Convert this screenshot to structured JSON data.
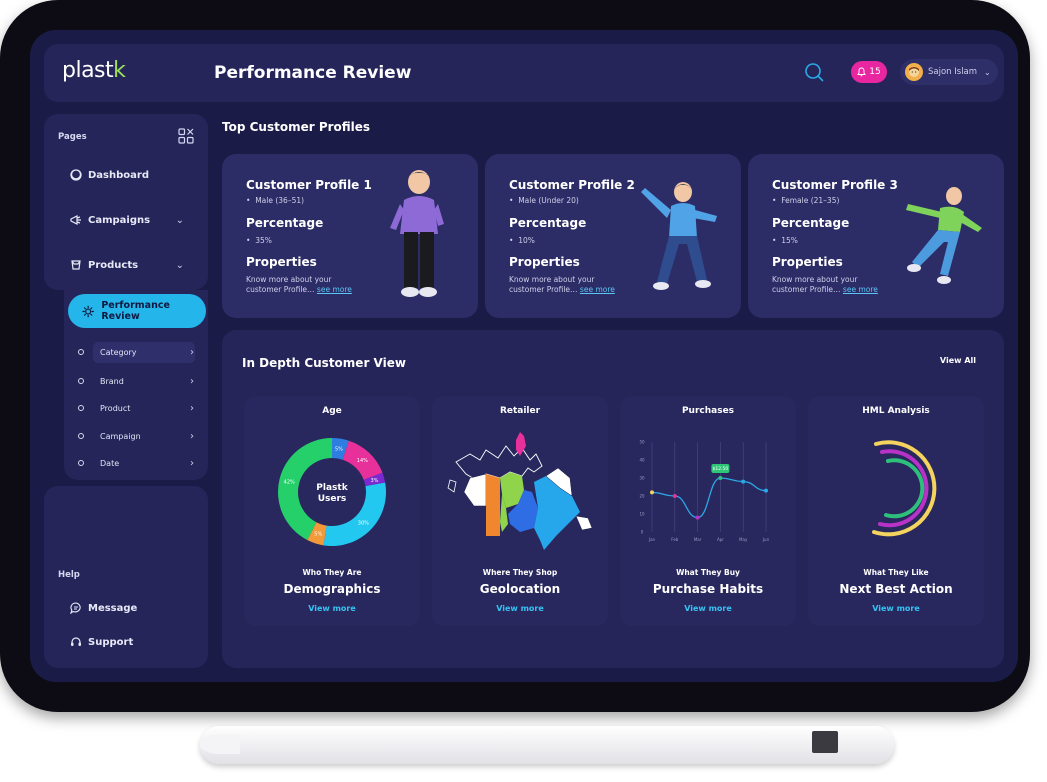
{
  "app": {
    "logo": "plastk",
    "logo_prefix": "plast",
    "logo_accent": "k",
    "page_title": "Performance Review"
  },
  "header": {
    "notifications": "15",
    "user_name": "Sajon Islam"
  },
  "sidebar": {
    "pages_label": "Pages",
    "items": [
      {
        "label": "Dashboard",
        "icon": "dashboard-icon"
      },
      {
        "label": "Campaigns",
        "icon": "megaphone-icon"
      },
      {
        "label": "Products",
        "icon": "box-icon"
      }
    ],
    "active": "Performance Review",
    "sub_items": [
      "Category",
      "Brand",
      "Product",
      "Campaign",
      "Date"
    ],
    "help_label": "Help",
    "help_items": [
      {
        "label": "Message",
        "icon": "message-icon"
      },
      {
        "label": "Support",
        "icon": "headset-icon"
      }
    ]
  },
  "main": {
    "section_title": "Top Customer Profiles",
    "profiles": [
      {
        "title": "Customer Profile 1",
        "gender": "Male (36–51)",
        "pct_label": "Percentage",
        "pct": "35%",
        "props_label": "Properties",
        "text1": "Know more about your",
        "text2": "customer Profile…",
        "link": "see more"
      },
      {
        "title": "Customer Profile 2",
        "gender": "Male (Under 20)",
        "pct_label": "Percentage",
        "pct": "10%",
        "props_label": "Properties",
        "text1": "Know more about your",
        "text2": "customer Profile…",
        "link": "see more"
      },
      {
        "title": "Customer Profile 3",
        "gender": "Female (21–35)",
        "pct_label": "Percentage",
        "pct": "15%",
        "props_label": "Properties",
        "text1": "Know more about your",
        "text2": "customer Profile…",
        "link": "see more"
      }
    ],
    "panel_title": "In Depth Customer View",
    "view_all": "View All",
    "columns": [
      {
        "title": "Age",
        "sub": "Who They Are",
        "head": "Demographics",
        "link": "View more"
      },
      {
        "title": "Retailer",
        "sub": "Where They Shop",
        "head": "Geolocation",
        "link": "View more"
      },
      {
        "title": "Purchases",
        "sub": "What They Buy",
        "head": "Purchase Habits",
        "link": "View more"
      },
      {
        "title": "HML Analysis",
        "sub": "What They Like",
        "head": "Next Best Action",
        "link": "View more"
      }
    ],
    "donut": {
      "center_line1": "Plastk",
      "center_line2": "Users"
    },
    "purchase_tooltip": "$12.50"
  },
  "colors": {
    "accent": "#24b6ea",
    "pink": "#e8269f",
    "bg": "#1b1b48",
    "card": "#2c2c66"
  },
  "chart_data": [
    {
      "type": "pie",
      "title": "Age",
      "labels": [
        "5%",
        "14%",
        "3%",
        "30%",
        "5%",
        "42%"
      ],
      "values": [
        5,
        14,
        3,
        30,
        5,
        42
      ],
      "colors": [
        "#2e7de0",
        "#e8309a",
        "#7b2ad1",
        "#22c8f0",
        "#f29a3a",
        "#25d06a"
      ]
    },
    {
      "type": "line",
      "title": "Purchases",
      "x": [
        "Jan",
        "Feb",
        "Mar",
        "Apr",
        "May",
        "Jun"
      ],
      "series": [
        {
          "values": [
            22,
            20,
            8,
            30,
            28,
            23
          ]
        }
      ],
      "ylim": [
        0,
        50
      ],
      "yticks": [
        0,
        10,
        20,
        30,
        40,
        50
      ]
    }
  ]
}
